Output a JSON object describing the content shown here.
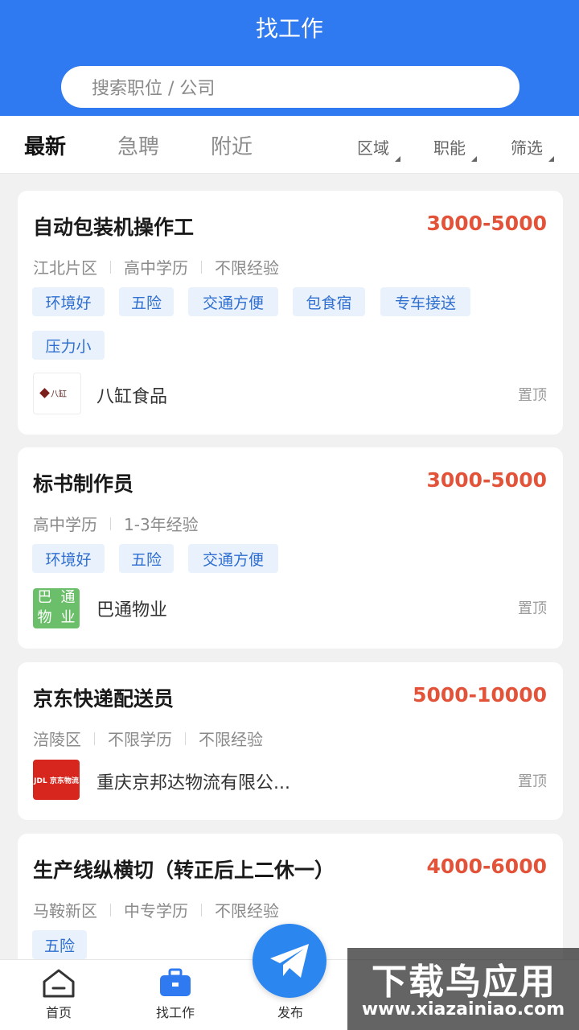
{
  "header": {
    "title": "找工作",
    "search_placeholder": "搜索职位 / 公司"
  },
  "tabs": [
    {
      "label": "最新"
    },
    {
      "label": "急聘"
    },
    {
      "label": "附近"
    }
  ],
  "filters": [
    {
      "label": "区域"
    },
    {
      "label": "职能"
    },
    {
      "label": "筛选"
    }
  ],
  "jobs": [
    {
      "title": "自动包装机操作工",
      "salary": "3000-5000",
      "meta": [
        "江北片区",
        "高中学历",
        "不限经验"
      ],
      "tags": [
        "环境好",
        "五险",
        "交通方便",
        "包食宿",
        "专车接送",
        "压力小"
      ],
      "company": "八缸食品",
      "logo_text": "八缸",
      "pin": "置顶"
    },
    {
      "title": "标书制作员",
      "salary": "3000-5000",
      "meta": [
        "高中学历",
        "1-3年经验"
      ],
      "tags": [
        "环境好",
        "五险",
        "交通方便"
      ],
      "company": "巴通物业",
      "logo_text": [
        "巴",
        "通",
        "物",
        "业"
      ],
      "pin": "置顶"
    },
    {
      "title": "京东快递配送员",
      "salary": "5000-10000",
      "meta": [
        "涪陵区",
        "不限学历",
        "不限经验"
      ],
      "tags": [],
      "company": "重庆京邦达物流有限公...",
      "logo_text": "JDL 京东物流",
      "pin": "置顶"
    },
    {
      "title": "生产线纵横切（转正后上二休一）",
      "salary": "4000-6000",
      "meta": [
        "马鞍新区",
        "中专学历",
        "不限经验"
      ],
      "tags": [
        "五险"
      ]
    }
  ],
  "bottom_nav": [
    {
      "label": "首页"
    },
    {
      "label": "找工作"
    },
    {
      "label": "发布"
    }
  ],
  "watermark": {
    "main": "下载鸟应用",
    "url": "www.xiazainiao.com"
  },
  "colors": {
    "primary": "#2f7af0",
    "salary": "#e2533a",
    "tag_bg": "#e9f1fc",
    "tag_text": "#2f6fd0"
  }
}
